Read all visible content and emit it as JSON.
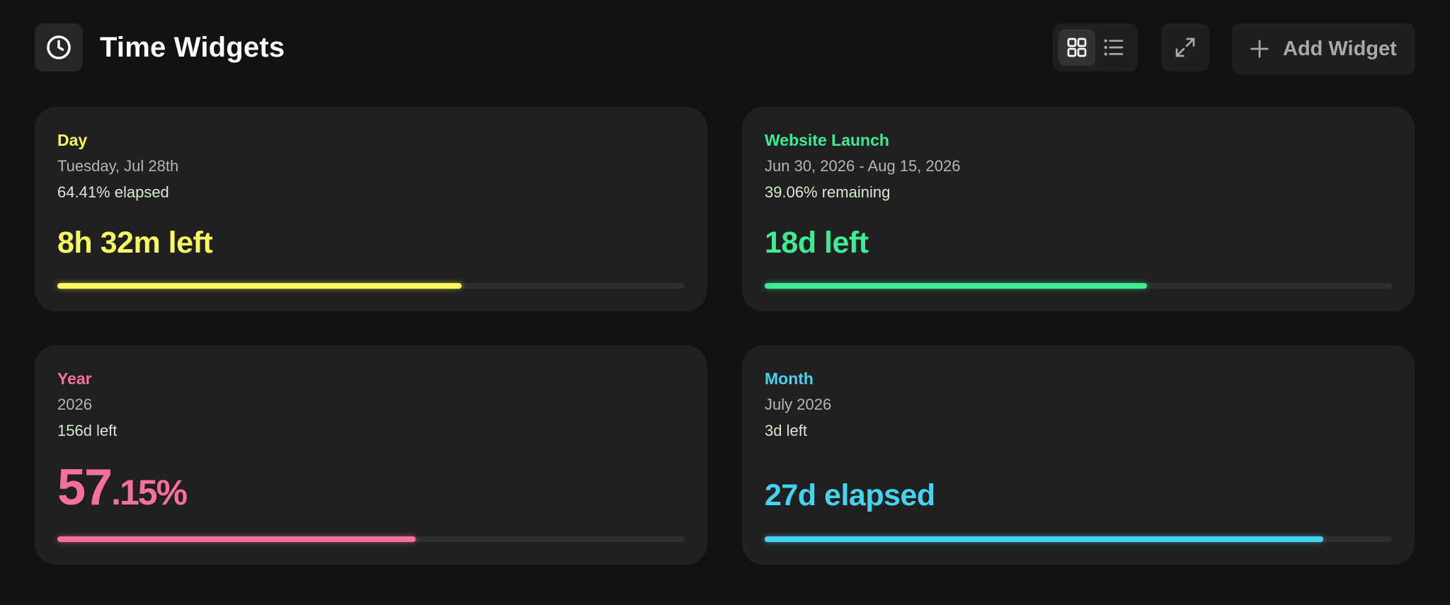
{
  "header": {
    "title": "Time Widgets",
    "logo_icon": "clock-icon",
    "add_widget_label": "Add Widget"
  },
  "colors": {
    "background": "#121212",
    "card": "#202020",
    "yellow": "#f8f860",
    "green": "#3eeb94",
    "pink": "#f5709a",
    "blue": "#44d4f2"
  },
  "widgets": [
    {
      "label": "Day",
      "subtitle": "Tuesday, Jul 28th",
      "status": "64.41% elapsed",
      "big": "8h 32m left",
      "progress": 0.6441,
      "color": "#f8f860"
    },
    {
      "label": "Website Launch",
      "subtitle": "Jun 30, 2026 - Aug 15, 2026",
      "status": "39.06% remaining",
      "big": "18d left",
      "progress": 0.6094,
      "color": "#3eeb94"
    },
    {
      "label": "Year",
      "subtitle": "2026",
      "status": "156d left",
      "big_int": "57",
      "big_dec": ".15%",
      "progress": 0.5715,
      "color": "#f5709a"
    },
    {
      "label": "Month",
      "subtitle": "July 2026",
      "status": "3d left",
      "big": "27d elapsed",
      "progress": 0.8903,
      "color": "#44d4f2"
    }
  ]
}
